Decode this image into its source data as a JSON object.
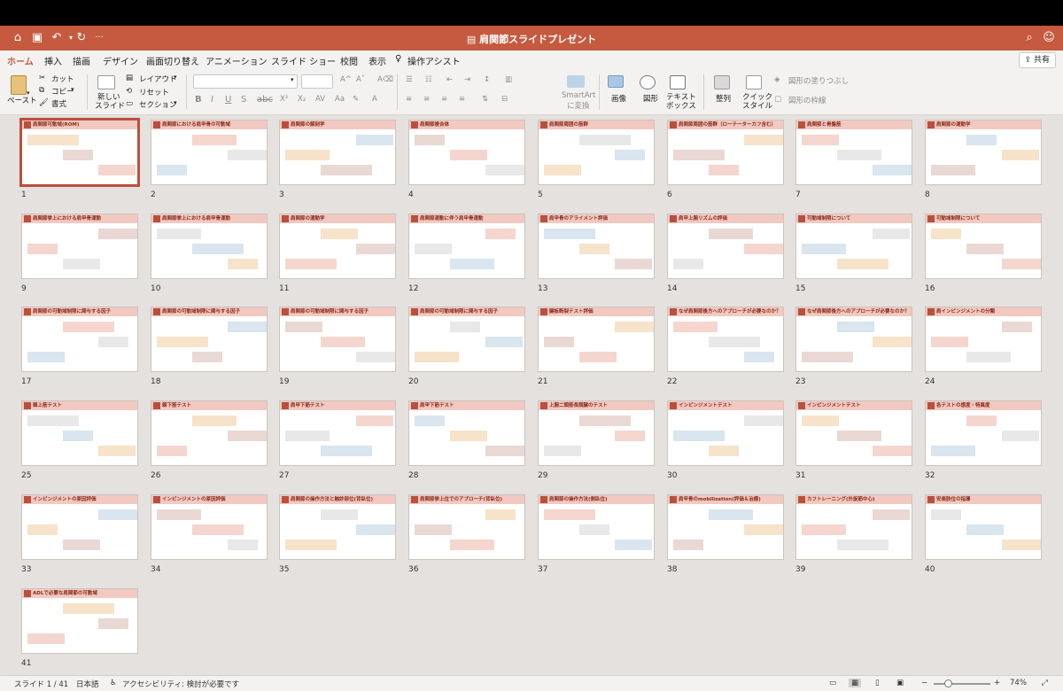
{
  "window": {
    "title": "肩関節スライドプレゼント"
  },
  "tabs": [
    "ホーム",
    "挿入",
    "描画",
    "デザイン",
    "画面切り替え",
    "アニメーション",
    "スライド ショー",
    "校閲",
    "表示",
    "操作アシスト"
  ],
  "share_label": "共有",
  "ribbon": {
    "paste": "ペースト",
    "cut": "カット",
    "copy": "コピー",
    "format": "書式",
    "new_slide_line1": "新しい",
    "new_slide_line2": "スライド",
    "layout": "レイアウト",
    "reset": "リセット",
    "section": "セクション",
    "smartart_line1": "SmartArt",
    "smartart_line2": "に変換",
    "image": "画像",
    "shape": "図形",
    "textbox_line1": "テキスト",
    "textbox_line2": "ボックス",
    "arrange": "整列",
    "quick_style_line1": "クイック",
    "quick_style_line2": "スタイル",
    "shape_fill": "図形の塗りつぶし",
    "shape_outline": "図形の枠線"
  },
  "slides": [
    {
      "n": "1",
      "title": "肩関節可動域(ROM)"
    },
    {
      "n": "2",
      "title": "肩関節における肩甲骨の可動域"
    },
    {
      "n": "3",
      "title": "肩関節の解剖学"
    },
    {
      "n": "4",
      "title": "肩関節複合体"
    },
    {
      "n": "5",
      "title": "肩関節周囲の筋群"
    },
    {
      "n": "6",
      "title": "肩関節周囲の筋群（ローテーターカフ含む）"
    },
    {
      "n": "7",
      "title": "肩関節と骨盤筋"
    },
    {
      "n": "8",
      "title": "肩関節の運動学"
    },
    {
      "n": "9",
      "title": "肩関節挙上における肩甲骨運動"
    },
    {
      "n": "10",
      "title": "肩関節挙上における肩甲骨運動"
    },
    {
      "n": "11",
      "title": "肩関節の運動学"
    },
    {
      "n": "12",
      "title": "肩関節運動に伴う肩甲骨運動"
    },
    {
      "n": "13",
      "title": "肩甲骨のアライメント評価"
    },
    {
      "n": "14",
      "title": "肩甲上腕リズムの評価"
    },
    {
      "n": "15",
      "title": "可動域制限について"
    },
    {
      "n": "16",
      "title": "可動域制限について"
    },
    {
      "n": "17",
      "title": "肩関節の可動域制限に関与する因子"
    },
    {
      "n": "18",
      "title": "肩関節の可動域制限に関与する因子"
    },
    {
      "n": "19",
      "title": "肩関節の可動域制限に関与する因子"
    },
    {
      "n": "20",
      "title": "肩関節の可動域制限に関与する因子"
    },
    {
      "n": "21",
      "title": "腱板断裂テスト評価"
    },
    {
      "n": "22",
      "title": "なぜ肩関節後方へのアプローチが必要なのか？"
    },
    {
      "n": "23",
      "title": "なぜ肩関節後方へのアプローチが必要なのか？"
    },
    {
      "n": "24",
      "title": "肩インピンジメントの分類"
    },
    {
      "n": "25",
      "title": "棘上筋テスト"
    },
    {
      "n": "26",
      "title": "棘下筋テスト"
    },
    {
      "n": "27",
      "title": "肩甲下筋テスト"
    },
    {
      "n": "28",
      "title": "肩甲下筋テスト"
    },
    {
      "n": "29",
      "title": "上腕二頭筋長頭腱のテスト"
    },
    {
      "n": "30",
      "title": "インピンジメントテスト"
    },
    {
      "n": "31",
      "title": "インピンジメントテスト"
    },
    {
      "n": "32",
      "title": "各テストの感度・特異度"
    },
    {
      "n": "33",
      "title": "インピンジメントの原因評価"
    },
    {
      "n": "34",
      "title": "インピンジメントの原因評価"
    },
    {
      "n": "35",
      "title": "肩関節の操作方法と触診部位(背臥位)"
    },
    {
      "n": "36",
      "title": "肩関節挙上位でのアプローチ(背臥位)"
    },
    {
      "n": "37",
      "title": "肩関節の操作方法(側臥位)"
    },
    {
      "n": "38",
      "title": "肩甲骨のmobilization(評価＆治療)"
    },
    {
      "n": "39",
      "title": "カフトレーニング(外旋筋中心)"
    },
    {
      "n": "40",
      "title": "安楽肢位の指導"
    },
    {
      "n": "41",
      "title": "ADLで必要な肩関節の可動域"
    }
  ],
  "status": {
    "slide": "スライド 1 / 41",
    "lang": "日本語",
    "accessibility": "アクセシビリティ: 検討が必要です",
    "zoom": "74%"
  },
  "colors": {
    "accent": "#c55a3f",
    "header_pink": "#f2c9c1",
    "marker": "#b9503c"
  }
}
